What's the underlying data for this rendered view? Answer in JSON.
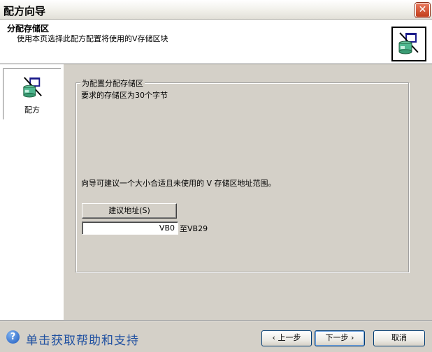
{
  "window": {
    "title": "配方向导",
    "close_symbol": "✕"
  },
  "header": {
    "title": "分配存储区",
    "description": "使用本页选择此配方配置将使用的V存储区块",
    "icon": "recipe-icon"
  },
  "sidebar": {
    "items": [
      {
        "label": "配方",
        "icon": "recipe-icon"
      }
    ]
  },
  "main": {
    "group_title": "为配置分配存储区",
    "required_text": "要求的存储区为30个字节",
    "hint_text": "向导可建议一个大小合适且未使用的 V 存储区地址范围。",
    "suggest_button": "建议地址(S)",
    "address_value": "VB0",
    "range_end": "至VB29"
  },
  "footer": {
    "help_symbol": "?",
    "help_link": "单击获取帮助和支持",
    "prev_button": "‹ 上一步",
    "next_button": "下一步 ›",
    "cancel_button": "取消"
  }
}
